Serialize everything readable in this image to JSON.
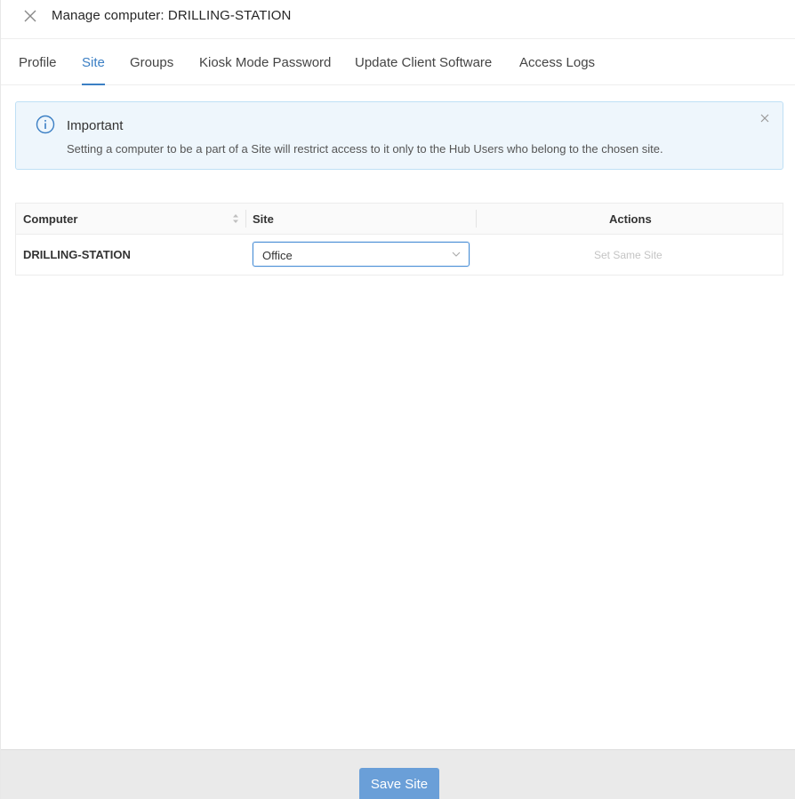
{
  "header": {
    "title": "Manage computer: DRILLING-STATION"
  },
  "tabs": [
    {
      "label": "Profile",
      "active": false
    },
    {
      "label": "Site",
      "active": true
    },
    {
      "label": "Groups",
      "active": false
    },
    {
      "label": "Kiosk Mode Password",
      "active": false
    },
    {
      "label": "Update Client Software",
      "active": false
    },
    {
      "label": "Access Logs",
      "active": false
    }
  ],
  "alert": {
    "title": "Important",
    "message": "Setting a computer to be a part of a Site will restrict access to it only to the Hub Users who belong to the chosen site."
  },
  "table": {
    "columns": [
      "Computer",
      "Site",
      "Actions"
    ],
    "rows": [
      {
        "computer": "DRILLING-STATION",
        "site": "Office",
        "action": "Set Same Site"
      }
    ]
  },
  "footer": {
    "save_label": "Save Site"
  },
  "colors": {
    "accent": "#3b7fc4",
    "alert_bg": "#eef6fc",
    "alert_border": "#bfe0f5",
    "button_bg": "#6a9fd8",
    "disabled_text": "#c4c4c4"
  }
}
